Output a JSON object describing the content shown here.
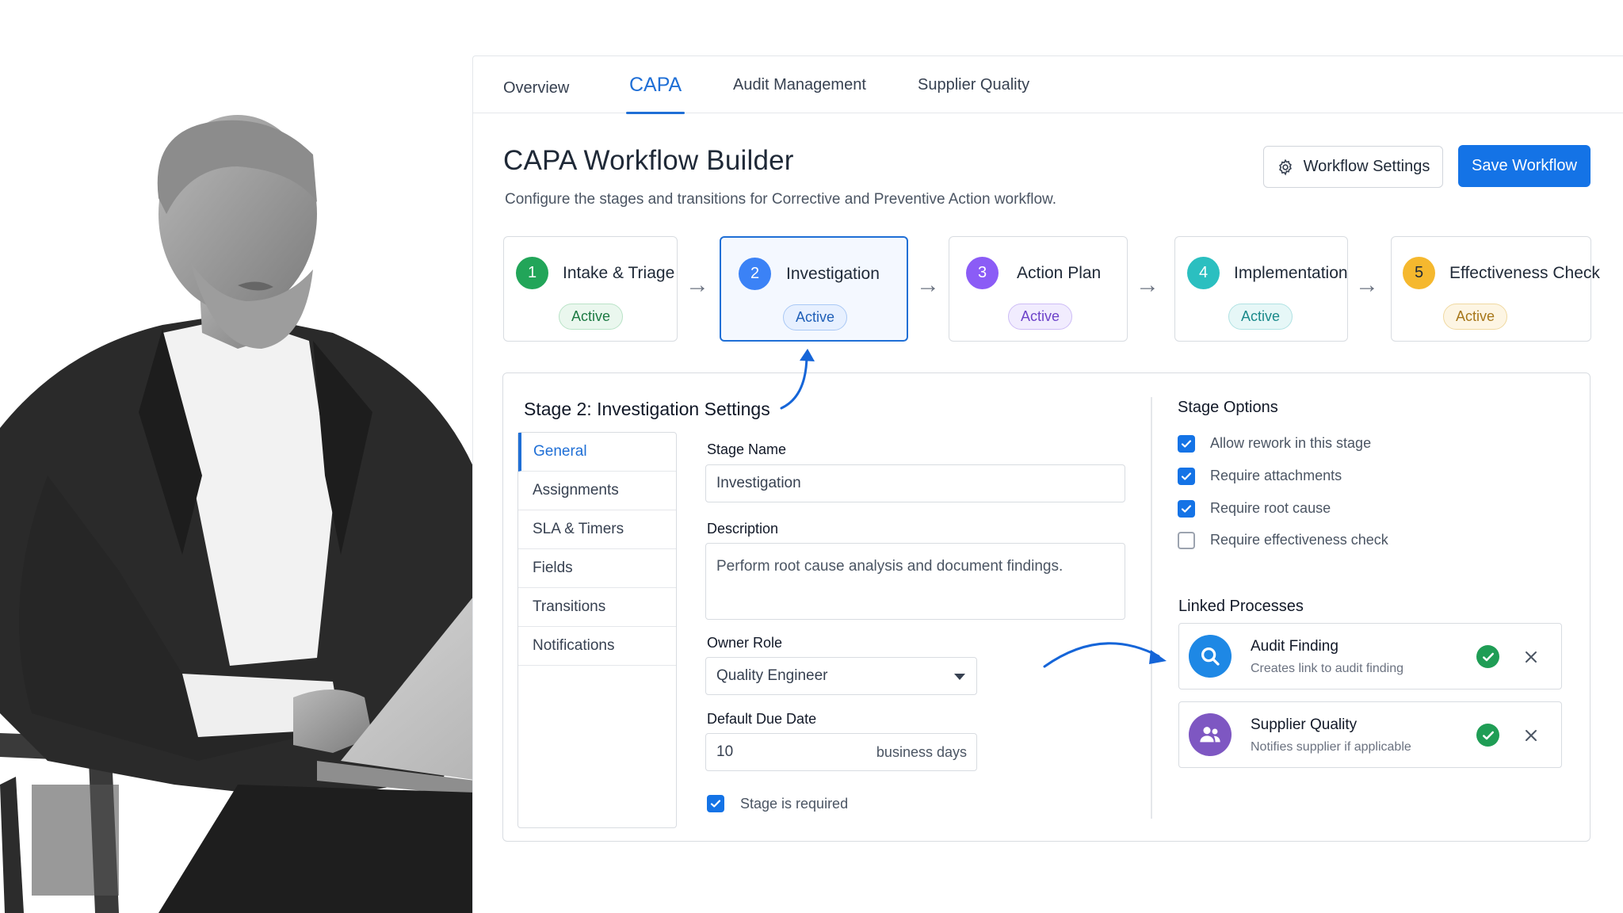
{
  "tabs": [
    "Overview",
    "CAPA",
    "Audit Management",
    "Supplier Quality"
  ],
  "active_tab": "CAPA",
  "header": {
    "title": "CAPA Workflow Builder",
    "subtitle": "Configure the stages and transitions for Corrective and Preventive Action workflow.",
    "settings_label": "Workflow Settings",
    "save_label": "Save Workflow"
  },
  "stages": [
    {
      "num": "1",
      "name": "Intake & Triage",
      "status": "Active",
      "color": "#22a559",
      "badge_bg": "#eaf7ee",
      "badge_border": "#b9e3c7",
      "badge_text": "#1d7a43"
    },
    {
      "num": "2",
      "name": "Investigation",
      "status": "Active",
      "color": "#3b82f6",
      "badge_bg": "#e7f0ff",
      "badge_border": "#a9c8f5",
      "badge_text": "#1f5fb8"
    },
    {
      "num": "3",
      "name": "Action Plan",
      "status": "Active",
      "color": "#8b5cf6",
      "badge_bg": "#f1ecfe",
      "badge_border": "#cdbcf6",
      "badge_text": "#6d43c9"
    },
    {
      "num": "4",
      "name": "Implementation",
      "status": "Active",
      "color": "#2bbfc0",
      "badge_bg": "#e6f7f7",
      "badge_border": "#b0e2e3",
      "badge_text": "#1b8a8b"
    },
    {
      "num": "5",
      "name": "Effectiveness Check",
      "status": "Active",
      "color": "#f5b82e",
      "badge_bg": "#fdf5e3",
      "badge_border": "#f0d9a1",
      "badge_text": "#a7771a"
    }
  ],
  "settings": {
    "title": "Stage 2: Investigation Settings",
    "nav": [
      "General",
      "Assignments",
      "SLA & Timers",
      "Fields",
      "Transitions",
      "Notifications"
    ],
    "active_nav": "General",
    "stage_name_label": "Stage Name",
    "stage_name_value": "Investigation",
    "description_label": "Description",
    "description_value": "Perform root cause analysis and document findings.",
    "owner_label": "Owner Role",
    "owner_value": "Quality Engineer",
    "due_label": "Default Due Date",
    "due_value": "10",
    "due_suffix": "business days",
    "required_label": "Stage is required",
    "required_checked": true
  },
  "stage_options": {
    "title": "Stage Options",
    "items": [
      {
        "label": "Allow rework in this stage",
        "checked": true
      },
      {
        "label": "Require attachments",
        "checked": true
      },
      {
        "label": "Require root cause",
        "checked": true
      },
      {
        "label": "Require effectiveness check",
        "checked": false
      }
    ]
  },
  "linked": {
    "title": "Linked Processes",
    "items": [
      {
        "name": "Audit Finding",
        "desc": "Creates link to audit finding",
        "icon": "search-icon",
        "color": "#1e88e5"
      },
      {
        "name": "Supplier Quality",
        "desc": "Notifies supplier if applicable",
        "icon": "users-icon",
        "color": "#7e57c2"
      }
    ]
  },
  "accent_color": "#1473e6"
}
